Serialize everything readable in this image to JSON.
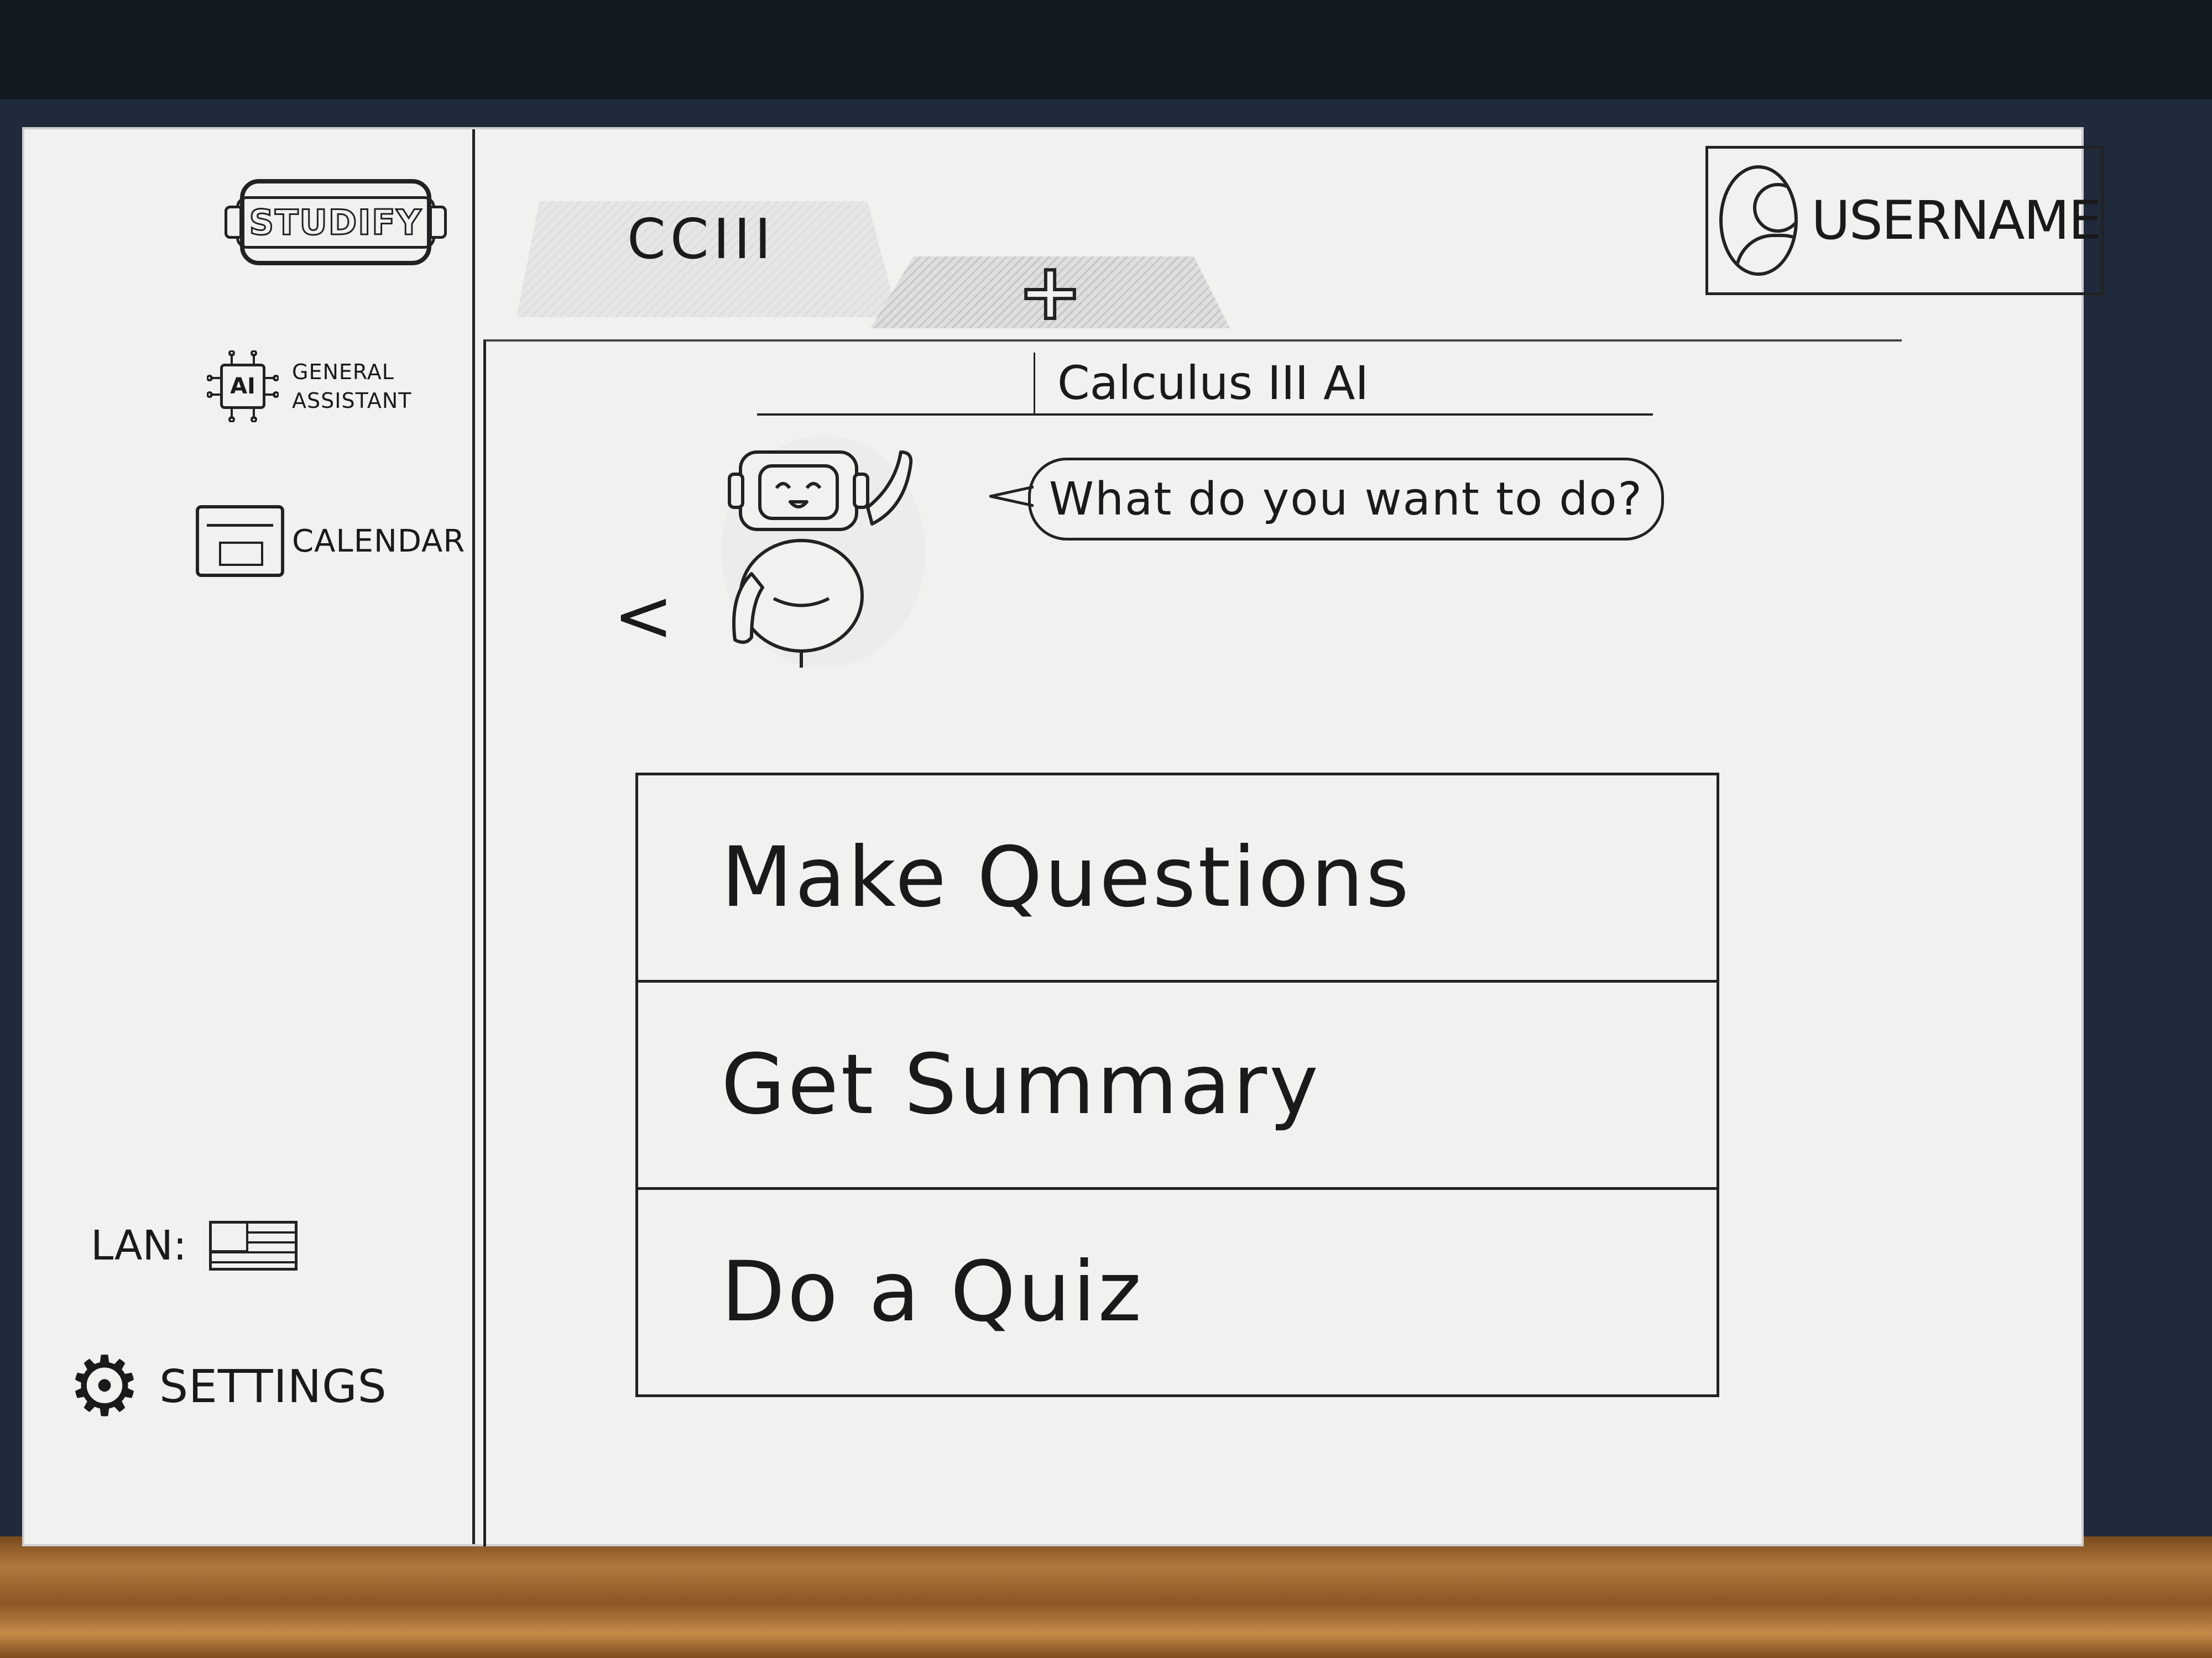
{
  "app": {
    "logo_text": "STUDIFY"
  },
  "sidebar": {
    "items": [
      {
        "icon": "ai-chip-icon",
        "icon_text": "AI",
        "label_line1": "GENERAL",
        "label_line2": "ASSISTANT"
      },
      {
        "icon": "calendar-icon",
        "label": "CALENDAR"
      }
    ],
    "language_label": "LAN:",
    "language_icon": "flag-icon",
    "settings_label": "SETTINGS",
    "settings_icon": "gear-icon"
  },
  "tabs": {
    "items": [
      {
        "label": "CCIII"
      }
    ],
    "add_icon": "plus-icon",
    "add_symbol": "+"
  },
  "user": {
    "username": "USERNAME",
    "avatar_icon": "user-avatar-icon"
  },
  "chat": {
    "title": "Calculus III AI",
    "back_symbol": "<",
    "bot_icon": "robot-mascot-icon",
    "prompt": "What do you want to do?"
  },
  "options": [
    {
      "label": "Make Questions"
    },
    {
      "label": "Get Summary"
    },
    {
      "label": "Do a Quiz"
    }
  ],
  "colors": {
    "ink": "#1a1a1a",
    "paper": "#f1f1f0",
    "desk": "#1f2a3b"
  }
}
